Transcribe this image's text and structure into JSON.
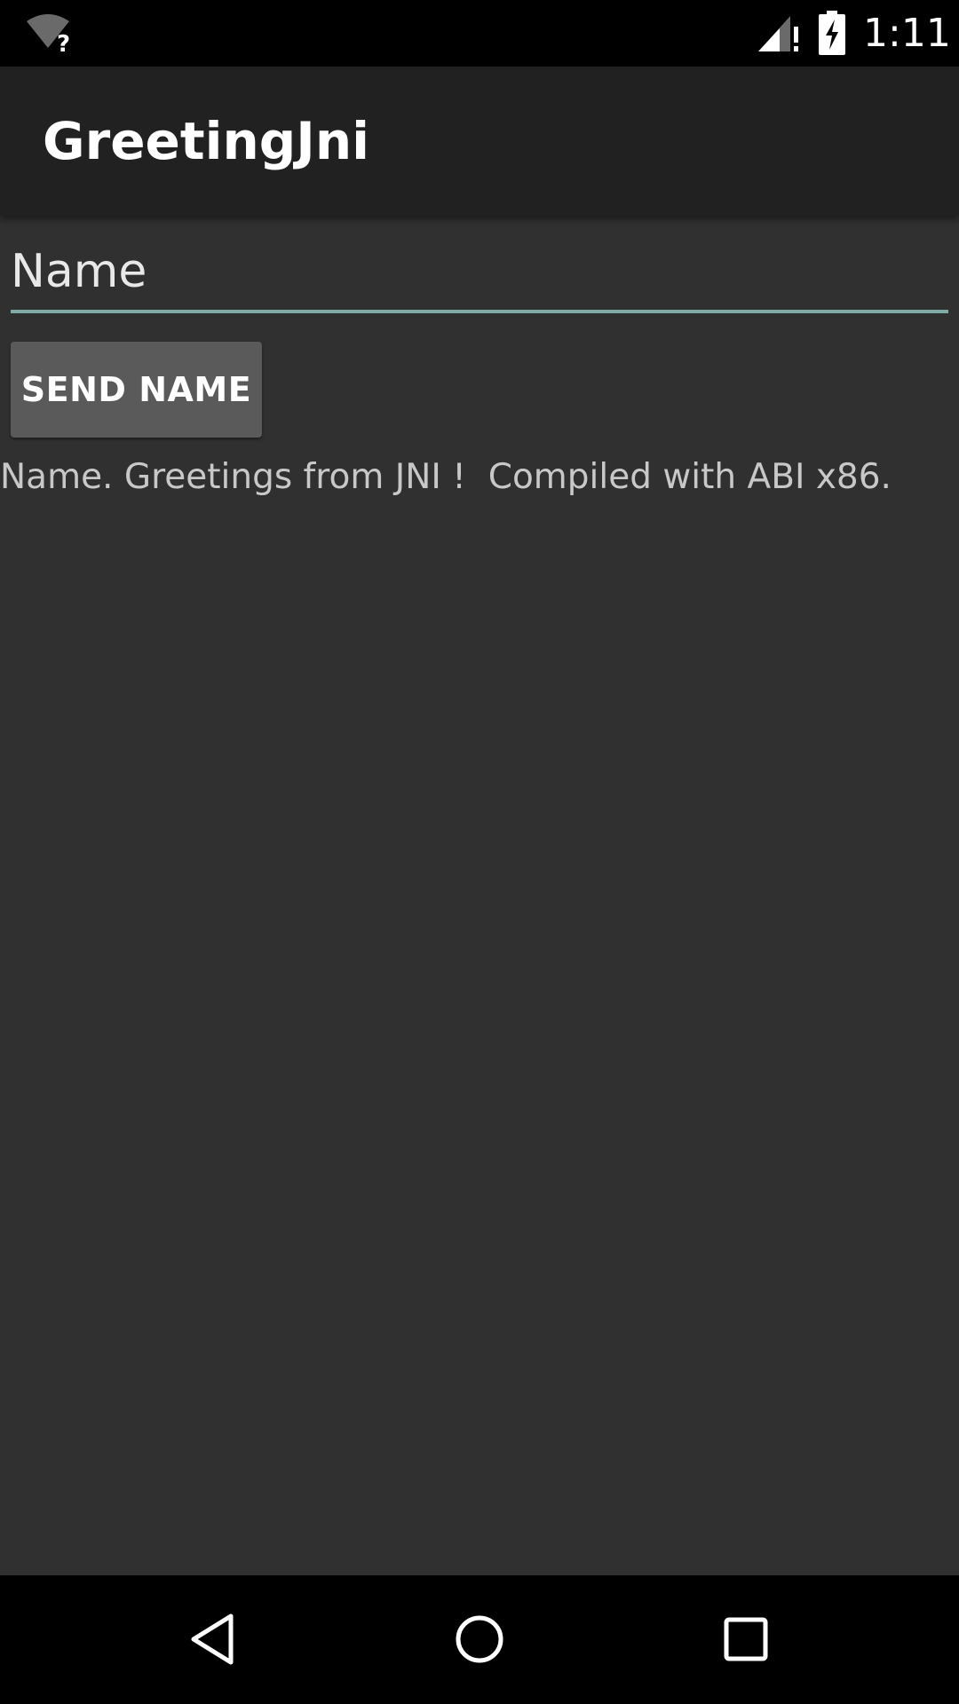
{
  "status_bar": {
    "time": "1:11",
    "icons": [
      "wifi-no-internet-icon",
      "cell-signal-alert-icon",
      "battery-charging-icon"
    ]
  },
  "app_bar": {
    "title": "GreetingJni"
  },
  "form": {
    "name_placeholder": "Name",
    "name_value": "",
    "send_button_label": "SEND NAME"
  },
  "output": {
    "greeting": "Name. Greetings from JNI !  Compiled with ABI x86."
  },
  "nav_bar": {
    "icons": [
      "back-icon",
      "home-icon",
      "recents-icon"
    ]
  },
  "colors": {
    "background": "#303030",
    "app_bar": "#212121",
    "accent_underline": "#80aaa6",
    "button": "#5a5a5a"
  }
}
